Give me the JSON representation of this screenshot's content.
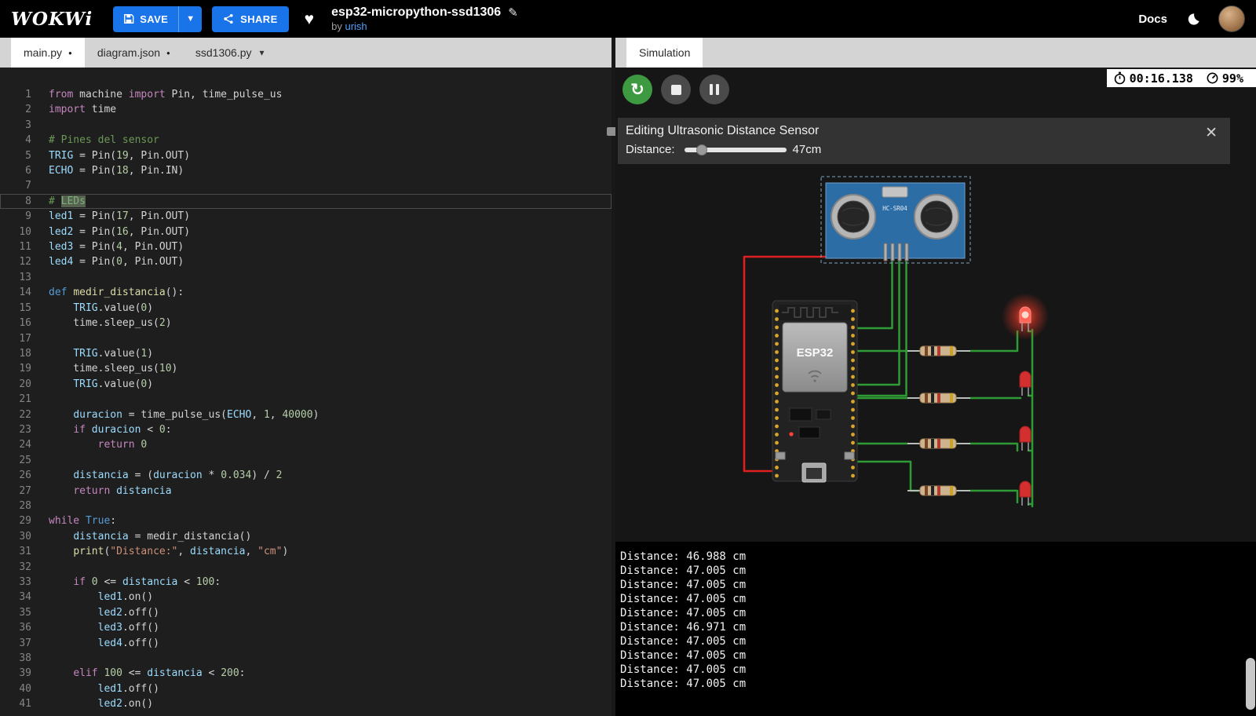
{
  "topbar": {
    "logo": "WOKWi",
    "save_label": "SAVE",
    "share_label": "SHARE",
    "project_title": "esp32-micropython-ssd1306",
    "by_label": "by",
    "author": "urish",
    "docs_label": "Docs"
  },
  "colors": {
    "accent_blue": "#1a74e9",
    "wire_green": "#2e9b35",
    "wire_red": "#e02020",
    "led_red": "#e53935",
    "sensor_blue": "#2d6da6"
  },
  "editor": {
    "tabs": [
      {
        "label": "main.py",
        "modified": true,
        "active": true
      },
      {
        "label": "diagram.json",
        "modified": true,
        "active": false
      },
      {
        "label": "ssd1306.py",
        "modified": false,
        "active": false
      }
    ],
    "lines": [
      {
        "n": 1,
        "t": [
          [
            "kw",
            "from"
          ],
          [
            "pl",
            " machine "
          ],
          [
            "kw",
            "import"
          ],
          [
            "pl",
            " Pin, time_pulse_us"
          ]
        ]
      },
      {
        "n": 2,
        "t": [
          [
            "kw",
            "import"
          ],
          [
            "pl",
            " time"
          ]
        ]
      },
      {
        "n": 3,
        "t": []
      },
      {
        "n": 4,
        "t": [
          [
            "com",
            "# Pines del sensor"
          ]
        ]
      },
      {
        "n": 5,
        "t": [
          [
            "var",
            "TRIG"
          ],
          [
            "pl",
            " = Pin("
          ],
          [
            "num",
            "19"
          ],
          [
            "pl",
            ", Pin.OUT)"
          ]
        ]
      },
      {
        "n": 6,
        "t": [
          [
            "var",
            "ECHO"
          ],
          [
            "pl",
            " = Pin("
          ],
          [
            "num",
            "18"
          ],
          [
            "pl",
            ", Pin.IN)"
          ]
        ]
      },
      {
        "n": 7,
        "t": []
      },
      {
        "n": 8,
        "current": true,
        "t": [
          [
            "com",
            "# "
          ],
          [
            "comhl",
            "LEDs"
          ]
        ]
      },
      {
        "n": 9,
        "t": [
          [
            "var",
            "led1"
          ],
          [
            "pl",
            " = Pin("
          ],
          [
            "num",
            "17"
          ],
          [
            "pl",
            ", Pin.OUT)"
          ]
        ]
      },
      {
        "n": 10,
        "t": [
          [
            "var",
            "led2"
          ],
          [
            "pl",
            " = Pin("
          ],
          [
            "num",
            "16"
          ],
          [
            "pl",
            ", Pin.OUT)"
          ]
        ]
      },
      {
        "n": 11,
        "t": [
          [
            "var",
            "led3"
          ],
          [
            "pl",
            " = Pin("
          ],
          [
            "num",
            "4"
          ],
          [
            "pl",
            ", Pin.OUT)"
          ]
        ]
      },
      {
        "n": 12,
        "t": [
          [
            "var",
            "led4"
          ],
          [
            "pl",
            " = Pin("
          ],
          [
            "num",
            "0"
          ],
          [
            "pl",
            ", Pin.OUT)"
          ]
        ]
      },
      {
        "n": 13,
        "t": []
      },
      {
        "n": 14,
        "t": [
          [
            "kw2",
            "def"
          ],
          [
            "pl",
            " "
          ],
          [
            "fn",
            "medir_distancia"
          ],
          [
            "pl",
            "():"
          ]
        ]
      },
      {
        "n": 15,
        "t": [
          [
            "pl",
            "    "
          ],
          [
            "var",
            "TRIG"
          ],
          [
            "pl",
            ".value("
          ],
          [
            "num",
            "0"
          ],
          [
            "pl",
            ")"
          ]
        ]
      },
      {
        "n": 16,
        "t": [
          [
            "pl",
            "    time.sleep_us("
          ],
          [
            "num",
            "2"
          ],
          [
            "pl",
            ")"
          ]
        ]
      },
      {
        "n": 17,
        "t": []
      },
      {
        "n": 18,
        "t": [
          [
            "pl",
            "    "
          ],
          [
            "var",
            "TRIG"
          ],
          [
            "pl",
            ".value("
          ],
          [
            "num",
            "1"
          ],
          [
            "pl",
            ")"
          ]
        ]
      },
      {
        "n": 19,
        "t": [
          [
            "pl",
            "    time.sleep_us("
          ],
          [
            "num",
            "10"
          ],
          [
            "pl",
            ")"
          ]
        ]
      },
      {
        "n": 20,
        "t": [
          [
            "pl",
            "    "
          ],
          [
            "var",
            "TRIG"
          ],
          [
            "pl",
            ".value("
          ],
          [
            "num",
            "0"
          ],
          [
            "pl",
            ")"
          ]
        ]
      },
      {
        "n": 21,
        "t": []
      },
      {
        "n": 22,
        "t": [
          [
            "pl",
            "    "
          ],
          [
            "var",
            "duracion"
          ],
          [
            "pl",
            " = time_pulse_us("
          ],
          [
            "var",
            "ECHO"
          ],
          [
            "pl",
            ", "
          ],
          [
            "num",
            "1"
          ],
          [
            "pl",
            ", "
          ],
          [
            "num",
            "40000"
          ],
          [
            "pl",
            ")"
          ]
        ]
      },
      {
        "n": 23,
        "t": [
          [
            "pl",
            "    "
          ],
          [
            "kw",
            "if"
          ],
          [
            "pl",
            " "
          ],
          [
            "var",
            "duracion"
          ],
          [
            "pl",
            " < "
          ],
          [
            "num",
            "0"
          ],
          [
            "pl",
            ":"
          ]
        ]
      },
      {
        "n": 24,
        "t": [
          [
            "pl",
            "        "
          ],
          [
            "kw",
            "return"
          ],
          [
            "pl",
            " "
          ],
          [
            "num",
            "0"
          ]
        ]
      },
      {
        "n": 25,
        "t": []
      },
      {
        "n": 26,
        "t": [
          [
            "pl",
            "    "
          ],
          [
            "var",
            "distancia"
          ],
          [
            "pl",
            " = ("
          ],
          [
            "var",
            "duracion"
          ],
          [
            "pl",
            " * "
          ],
          [
            "num",
            "0.034"
          ],
          [
            "pl",
            ") / "
          ],
          [
            "num",
            "2"
          ]
        ]
      },
      {
        "n": 27,
        "t": [
          [
            "pl",
            "    "
          ],
          [
            "kw",
            "return"
          ],
          [
            "pl",
            " "
          ],
          [
            "var",
            "distancia"
          ]
        ]
      },
      {
        "n": 28,
        "t": []
      },
      {
        "n": 29,
        "t": [
          [
            "kw",
            "while"
          ],
          [
            "pl",
            " "
          ],
          [
            "kw2",
            "True"
          ],
          [
            "pl",
            ":"
          ]
        ]
      },
      {
        "n": 30,
        "t": [
          [
            "pl",
            "    "
          ],
          [
            "var",
            "distancia"
          ],
          [
            "pl",
            " = medir_distancia()"
          ]
        ]
      },
      {
        "n": 31,
        "t": [
          [
            "pl",
            "    "
          ],
          [
            "fn",
            "print"
          ],
          [
            "pl",
            "("
          ],
          [
            "str",
            "\"Distance:\""
          ],
          [
            "pl",
            ", "
          ],
          [
            "var",
            "distancia"
          ],
          [
            "pl",
            ", "
          ],
          [
            "str",
            "\"cm\""
          ],
          [
            "pl",
            ")"
          ]
        ]
      },
      {
        "n": 32,
        "t": []
      },
      {
        "n": 33,
        "t": [
          [
            "pl",
            "    "
          ],
          [
            "kw",
            "if"
          ],
          [
            "pl",
            " "
          ],
          [
            "num",
            "0"
          ],
          [
            "pl",
            " <= "
          ],
          [
            "var",
            "distancia"
          ],
          [
            "pl",
            " < "
          ],
          [
            "num",
            "100"
          ],
          [
            "pl",
            ":"
          ]
        ]
      },
      {
        "n": 34,
        "t": [
          [
            "pl",
            "        "
          ],
          [
            "var",
            "led1"
          ],
          [
            "pl",
            ".on()"
          ]
        ]
      },
      {
        "n": 35,
        "t": [
          [
            "pl",
            "        "
          ],
          [
            "var",
            "led2"
          ],
          [
            "pl",
            ".off()"
          ]
        ]
      },
      {
        "n": 36,
        "t": [
          [
            "pl",
            "        "
          ],
          [
            "var",
            "led3"
          ],
          [
            "pl",
            ".off()"
          ]
        ]
      },
      {
        "n": 37,
        "t": [
          [
            "pl",
            "        "
          ],
          [
            "var",
            "led4"
          ],
          [
            "pl",
            ".off()"
          ]
        ]
      },
      {
        "n": 38,
        "t": []
      },
      {
        "n": 39,
        "t": [
          [
            "pl",
            "    "
          ],
          [
            "kw",
            "elif"
          ],
          [
            "pl",
            " "
          ],
          [
            "num",
            "100"
          ],
          [
            "pl",
            " <= "
          ],
          [
            "var",
            "distancia"
          ],
          [
            "pl",
            " < "
          ],
          [
            "num",
            "200"
          ],
          [
            "pl",
            ":"
          ]
        ]
      },
      {
        "n": 40,
        "t": [
          [
            "pl",
            "        "
          ],
          [
            "var",
            "led1"
          ],
          [
            "pl",
            ".off()"
          ]
        ]
      },
      {
        "n": 41,
        "t": [
          [
            "pl",
            "        "
          ],
          [
            "var",
            "led2"
          ],
          [
            "pl",
            ".on()"
          ]
        ]
      }
    ]
  },
  "simulation": {
    "tab_label": "Simulation",
    "timer": "00:16.138",
    "cpu": "99%",
    "editing_panel": {
      "title": "Editing Ultrasonic Distance Sensor",
      "distance_label": "Distance:",
      "distance_value": "47cm"
    },
    "circuit": {
      "sensor_label": "HC-SR04",
      "board_label": "ESP32"
    },
    "serial_output": [
      "Distance: 46.988 cm",
      "Distance: 47.005 cm",
      "Distance: 47.005 cm",
      "Distance: 47.005 cm",
      "Distance: 47.005 cm",
      "Distance: 46.971 cm",
      "Distance: 47.005 cm",
      "Distance: 47.005 cm",
      "Distance: 47.005 cm",
      "Distance: 47.005 cm"
    ]
  }
}
